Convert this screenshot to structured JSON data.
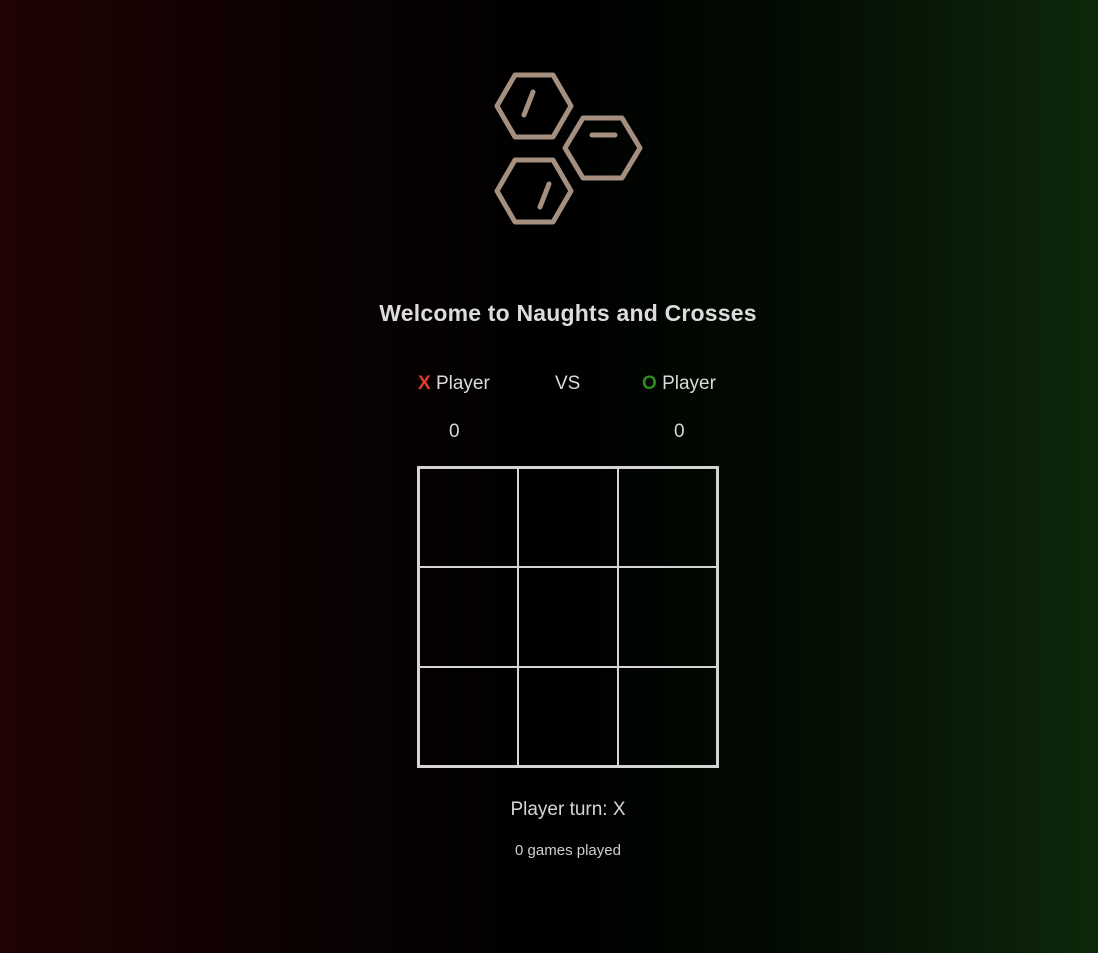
{
  "header": {
    "title": "Welcome to Naughts and Crosses"
  },
  "players": {
    "x": {
      "mark": "X",
      "label": "Player",
      "score": "0"
    },
    "vs": "VS",
    "o": {
      "mark": "O",
      "label": "Player",
      "score": "0"
    }
  },
  "board": {
    "cells": [
      "",
      "",
      "",
      "",
      "",
      "",
      "",
      "",
      ""
    ]
  },
  "status": {
    "turn_text": "Player turn: X",
    "games_played_text": "0 games played"
  },
  "colors": {
    "x_mark": "#e23b2c",
    "o_mark": "#2f8a22",
    "logo": "#a59080",
    "grid": "#d4d4d4"
  },
  "icons": {
    "logo": "hexagon-cluster-logo"
  }
}
